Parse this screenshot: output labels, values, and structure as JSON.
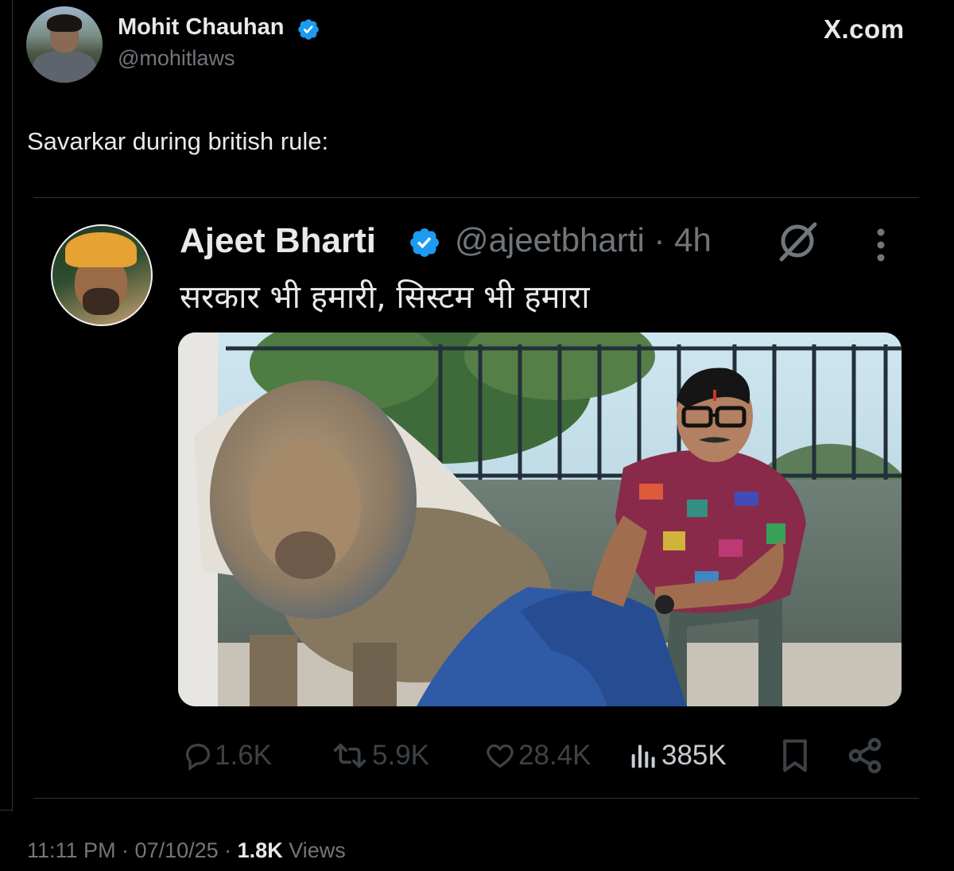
{
  "author": {
    "name": "Mohit Chauhan",
    "handle": "@mohitlaws"
  },
  "brand": "X.com",
  "tweet": {
    "text": "Savarkar during british rule:"
  },
  "quoted": {
    "name": "Ajeet Bharti",
    "handle": "@ajeetbharti",
    "time": " · 4h",
    "text": "सरकार भी हमारी, सिस्टम भी हमारा",
    "stats": {
      "replies": "1.6K",
      "reposts": "5.9K",
      "likes": "28.4K",
      "views": "385K"
    }
  },
  "footer": {
    "time": "11:11 PM · 07/10/25 · ",
    "views_count": "1.8K",
    "views_label": " Views"
  },
  "colors": {
    "background": "#000000",
    "verified": "#1d9bf0",
    "muted": "#71767b",
    "text": "#e7e9ea"
  },
  "icons": [
    "verified-badge-icon",
    "grok-icon",
    "more-icon",
    "reply-icon",
    "repost-icon",
    "like-icon",
    "views-icon",
    "bookmark-icon",
    "share-icon"
  ]
}
